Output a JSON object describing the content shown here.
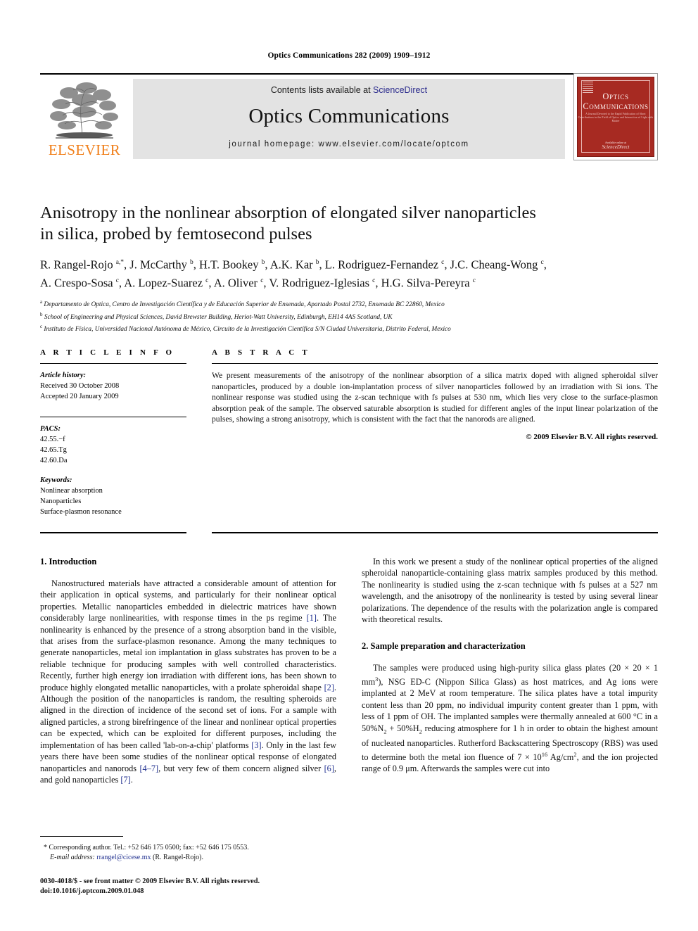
{
  "running_head": "Optics Communications 282 (2009) 1909–1912",
  "masthead": {
    "contents_prefix": "Contents lists available at ",
    "sciencedirect": "ScienceDirect",
    "journal_name": "Optics Communications",
    "homepage": "journal homepage: www.elsevier.com/locate/optcom",
    "publisher": "ELSEVIER",
    "cover": {
      "title_line1": "Optics",
      "title_line2": "Communications",
      "subtitle": "A Journal Devoted to the Rapid Publication of Short Contributions in the Field of Optics and Interaction of Light with Matter",
      "foot_available": "Available online at",
      "foot_mark": "ScienceDirect"
    },
    "accent_orange": "#f07f1a",
    "link_blue": "#2a2a8c",
    "banner_gray": "#e3e3e3",
    "cover_red": "#a72a22"
  },
  "article": {
    "title_line1": "Anisotropy in the nonlinear absorption of elongated silver nanoparticles",
    "title_line2": "in silica, probed by femtosecond pulses",
    "authors_line1": "R. Rangel-Rojo <sup>a,*</sup>, J. McCarthy <sup>b</sup>, H.T. Bookey <sup>b</sup>, A.K. Kar <sup>b</sup>, L. Rodriguez-Fernandez <sup>c</sup>, J.C. Cheang-Wong <sup>c</sup>,",
    "authors_line2": "A. Crespo-Sosa <sup>c</sup>, A. Lopez-Suarez <sup>c</sup>, A. Oliver <sup>c</sup>, V. Rodriguez-Iglesias <sup>c</sup>, H.G. Silva-Pereyra <sup>c</sup>",
    "affiliations": [
      "<sup>a</sup> Departamento de Optica, Centro de Investigación Científica y de Educación Superior de Ensenada, Apartado Postal 2732, Ensenada BC 22860, Mexico",
      "<sup>b</sup> School of Engineering and Physical Sciences, David Brewster Building, Heriot-Watt University, Edinburgh, EH14 4AS Scotland, UK",
      "<sup>c</sup> Instituto de Física, Universidad Nacional Autónoma de México, Circuito de la Investigación Científica S/N Ciudad Universitaria, Distrito Federal, Mexico"
    ]
  },
  "article_info": {
    "heading": "A R T I C L E    I N F O",
    "history_label": "Article history:",
    "received": "Received 30 October 2008",
    "accepted": "Accepted 20 January 2009",
    "pacs_label": "PACS:",
    "pacs": [
      "42.55.−f",
      "42.65.Tg",
      "42.60.Da"
    ],
    "keywords_label": "Keywords:",
    "keywords": [
      "Nonlinear absorption",
      "Nanoparticles",
      "Surface-plasmon resonance"
    ]
  },
  "abstract": {
    "heading": "A B S T R A C T",
    "text": "We present measurements of the anisotropy of the nonlinear absorption of a silica matrix doped with aligned spheroidal silver nanoparticles, produced by a double ion-implantation process of silver nanoparticles followed by an irradiation with Si ions. The nonlinear response was studied using the z-scan technique with fs pulses at 530 nm, which lies very close to the surface-plasmon absorption peak of the sample. The observed saturable absorption is studied for different angles of the input linear polarization of the pulses, showing a strong anisotropy, which is consistent with the fact that the nanorods are aligned.",
    "copyright": "© 2009 Elsevier B.V. All rights reserved."
  },
  "body": {
    "section1_heading": "1. Introduction",
    "section1_para1": "Nanostructured materials have attracted a considerable amount of attention for their application in optical systems, and particularly for their nonlinear optical properties. Metallic nanoparticles embedded in dielectric matrices have shown considerably large nonlinearities, with response times in the ps regime [1]. The nonlinearity is enhanced by the presence of a strong absorption band in the visible, that arises from the surface-plasmon resonance. Among the many techniques to generate nanoparticles, metal ion implantation in glass substrates has proven to be a reliable technique for producing samples with well controlled characteristics. Recently, further high energy ion irradiation with different ions, has been shown to produce highly elongated metallic nanoparticles, with a prolate spheroidal shape [2]. Although the position of the nanoparticles is random, the resulting spheroids are aligned in the direction of incidence of the second set of ions. For a sample with aligned particles, a strong birefringence of the linear and nonlinear optical properties can be expected, which can be exploited for different purposes, including the implementation of has been called 'lab-on-a-chip' platforms [3]. Only in the last few years there have been some studies of the nonlinear optical response of elongated nanoparticles and nanorods [4–7], but very few of them concern aligned silver [6], and gold nanoparticles [7].",
    "section1_para2": "In this work we present a study of the nonlinear optical properties of the aligned spheroidal nanoparticle-containing glass matrix samples produced by this method. The nonlinearity is studied using the z-scan technique with fs pulses at a 527 nm wavelength, and the anisotropy of the nonlinearity is tested by using several linear polarizations. The dependence of the results with the polarization angle is compared with theoretical results.",
    "section2_heading": "2. Sample preparation and characterization",
    "section2_para1": "The samples were produced using high-purity silica glass plates (20 × 20 × 1 mm<sup class=\"tiny\">3</sup>), NSG ED-C (Nippon Silica Glass) as host matrices, and Ag ions were implanted at 2 MeV at room temperature. The silica plates have a total impurity content less than 20 ppm, no individual impurity content greater than 1 ppm, with less of 1 ppm of OH. The implanted samples were thermally annealed at 600 °C in a 50%N<sub class=\"tiny\">2</sub> + 50%H<sub class=\"tiny\">2</sub> reducing atmosphere for 1 h in order to obtain the highest amount of nucleated nanoparticles. Rutherford Backscattering Spectroscopy (RBS) was used to determine both the metal ion fluence of 7 × 10<sup class=\"tiny\">16</sup> Ag/cm<sup class=\"tiny\">2</sup>, and the ion projected range of 0.9 μm. Afterwards the samples were cut into"
  },
  "footnote": {
    "corresponding": "Corresponding author. Tel.: +52 646 175 0500; fax: +52 646 175 0553.",
    "email_label": "E-mail address:",
    "email": "rrangel@cicese.mx",
    "email_owner": "(R. Rangel-Rojo).",
    "imprint_line1": "0030-4018/$ - see front matter © 2009 Elsevier B.V. All rights reserved.",
    "imprint_line2": "doi:10.1016/j.optcom.2009.01.048"
  }
}
